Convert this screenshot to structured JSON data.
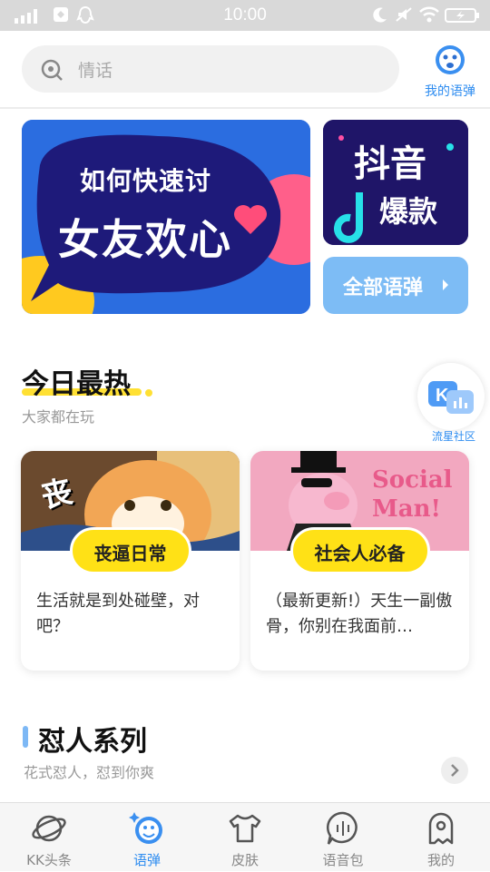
{
  "status_bar": {
    "time": "10:00"
  },
  "search": {
    "placeholder": "情话"
  },
  "my_bullets": {
    "label": "我的语弹"
  },
  "banners": {
    "main": {
      "line1": "如何快速讨",
      "line2": "女友欢心"
    },
    "douyin": {
      "line1": "抖音",
      "line2": "爆款"
    },
    "all": {
      "label": "全部语弹"
    }
  },
  "hot_section": {
    "title": "今日最热",
    "subtitle": "大家都在玩"
  },
  "community": {
    "label": "流星社区"
  },
  "cards": [
    {
      "overlay_text": "丧",
      "tag": "丧逼日常",
      "desc": "生活就是到处碰壁，对吧？"
    },
    {
      "overlay_text": "Social Man!",
      "tag": "社会人必备",
      "desc": "（最新更新!）天生一副傲骨，你别在我面前…"
    }
  ],
  "roast_section": {
    "title": "怼人系列",
    "subtitle": "花式怼人，怼到你爽"
  },
  "tabs": [
    {
      "label": "KK头条",
      "icon": "planet-icon"
    },
    {
      "label": "语弹",
      "icon": "bullet-icon",
      "active": true
    },
    {
      "label": "皮肤",
      "icon": "shirt-icon"
    },
    {
      "label": "语音包",
      "icon": "voice-icon"
    },
    {
      "label": "我的",
      "icon": "ghost-icon"
    }
  ],
  "colors": {
    "accent": "#2d8cf0",
    "highlight": "#ffe116"
  }
}
